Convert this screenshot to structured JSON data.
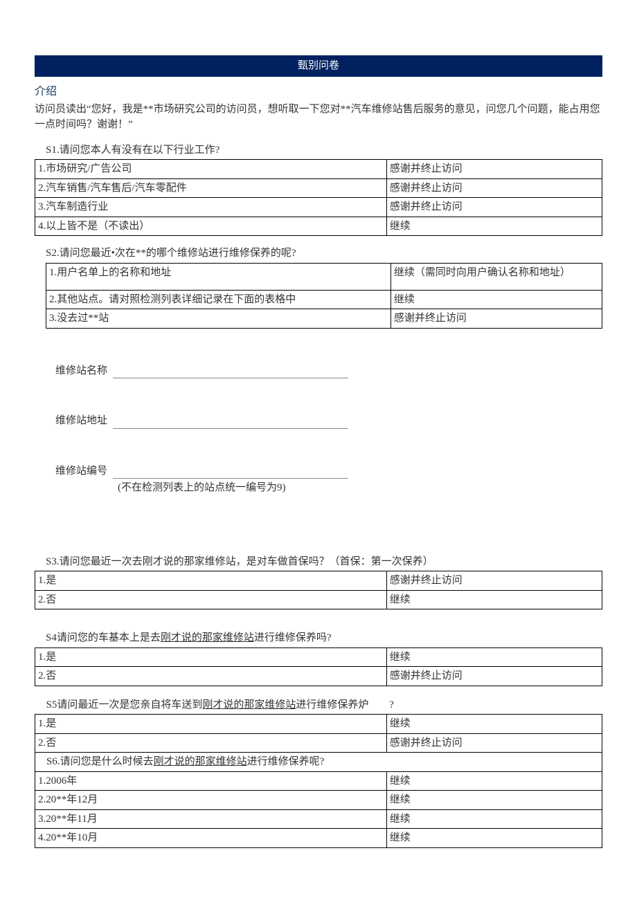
{
  "title": "甄别问卷",
  "intro": {
    "label": "介绍",
    "text": "访问员读出“您好，我是**市场研究公司的访问员，想听取一下您对**汽车维修站售后服务的意见，问您几个问题，能占用您一点时间吗？谢谢！”"
  },
  "s1": {
    "prompt": "S1.请问您本人有没有在以下行业工作?",
    "rows": [
      {
        "opt": "1.市场研究/广告公司",
        "action": "感谢并终止访问"
      },
      {
        "opt": "2.汽车销售/汽车售后/汽车零配件",
        "action": "感谢并终止访问"
      },
      {
        "opt": "3.汽车制造行业",
        "action": "感谢并终止访问"
      },
      {
        "opt": "4.以上皆不是（不读出）",
        "action": "继续"
      }
    ]
  },
  "s2": {
    "prompt": "S2.请问您最近•次在**的哪个维修站进行维修保养的呢?",
    "rows": [
      {
        "opt": "1.用户名单上的名称和地址",
        "action": "继续（需同时向用户确认名称和地址）"
      },
      {
        "opt": "2.其他站点。请对照检测列表详细记录在下面的表格中",
        "action": "继续"
      },
      {
        "opt": "3.没去过**站",
        "action": "感谢并终止访问"
      }
    ]
  },
  "fields": {
    "name_label": "维修站名称",
    "addr_label": "维修站地址",
    "code_label": "维修站编号",
    "code_note": "(不在检测列表上的站点统一编号为9)"
  },
  "s3": {
    "prompt": "S3.请问您最近一次去刚才说的那家维修站，是对车做首保吗？（首保：第一次保养）",
    "rows": [
      {
        "opt": "1.是",
        "action": "感谢并终止访问"
      },
      {
        "opt": "2.否",
        "action": "继续"
      }
    ]
  },
  "s4": {
    "prompt_pre": "S4请问您的车基本上是去",
    "prompt_u": "刚才说的那家维修站",
    "prompt_post": "进行维修保养吗?",
    "rows": [
      {
        "opt": "1.是",
        "action": "继续"
      },
      {
        "opt": "2.否",
        "action": "感谢并终止访问"
      }
    ]
  },
  "s5": {
    "prompt_pre": "S5请问最近一次是您亲自将车送到",
    "prompt_u": "刚才说的那家维修站",
    "prompt_post": "进行维修保养炉",
    "prompt_right": "?",
    "rows": [
      {
        "opt": "1.是",
        "action": "继续"
      },
      {
        "opt": "2.否",
        "action": "感谢并终止访问"
      }
    ]
  },
  "s6": {
    "prompt_pre": "S6.请问您是什么时候去",
    "prompt_u": "刚才说的那家维修站",
    "prompt_post": "进行维修保养呢?",
    "rows": [
      {
        "opt": "1.2006年",
        "action": "继续"
      },
      {
        "opt": "2.20**年12月",
        "action": "继续"
      },
      {
        "opt": "3.20**年11月",
        "action": "继续"
      },
      {
        "opt": "4.20**年10月",
        "action": "继续"
      }
    ]
  }
}
